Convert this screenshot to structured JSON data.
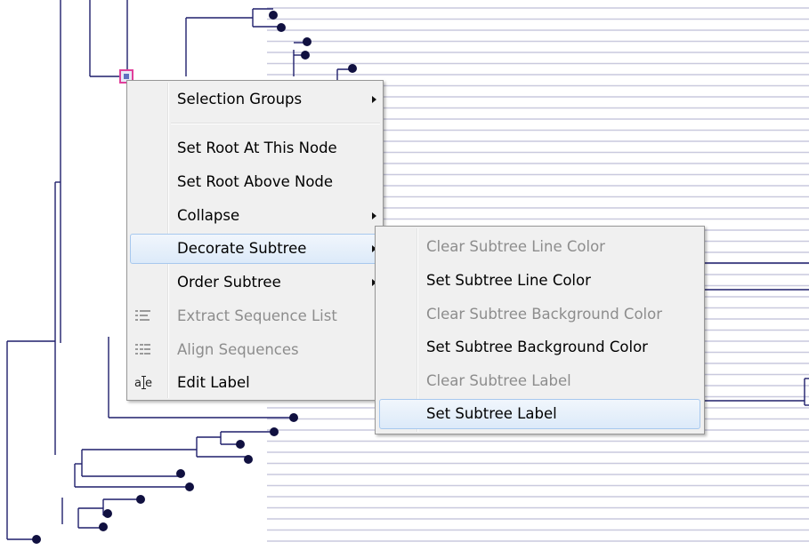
{
  "colors": {
    "tree_line": "#1f1f6b",
    "node_dot": "#101040",
    "guide_line": "#c9c9de",
    "selected_node": "#e0409a",
    "menu_bg": "#f0f0f0",
    "highlight_border": "#a7c8ee",
    "disabled_text": "#8d8d8d"
  },
  "context_menu": {
    "items": [
      {
        "label": "Selection Groups",
        "submenu": true,
        "enabled": true
      },
      {
        "label": "Set Root At This Node",
        "submenu": false,
        "enabled": true
      },
      {
        "label": "Set Root Above Node",
        "submenu": false,
        "enabled": true
      },
      {
        "label": "Collapse",
        "submenu": true,
        "enabled": true
      },
      {
        "label": "Decorate Subtree",
        "submenu": true,
        "enabled": true,
        "highlighted": true
      },
      {
        "label": "Order Subtree",
        "submenu": true,
        "enabled": true
      },
      {
        "label": "Extract Sequence List",
        "submenu": false,
        "enabled": false,
        "icon": "list-icon"
      },
      {
        "label": "Align Sequences",
        "submenu": false,
        "enabled": false,
        "icon": "align-sequences-icon"
      },
      {
        "label": "Edit Label",
        "submenu": false,
        "enabled": true,
        "icon": "edit-label-icon"
      }
    ]
  },
  "decorate_submenu": {
    "items": [
      {
        "label": "Clear Subtree Line Color",
        "enabled": false
      },
      {
        "label": "Set Subtree Line Color",
        "enabled": true
      },
      {
        "label": "Clear Subtree Background Color",
        "enabled": false
      },
      {
        "label": "Set Subtree Background Color",
        "enabled": true
      },
      {
        "label": "Clear Subtree Label",
        "enabled": false
      },
      {
        "label": "Set Subtree Label",
        "enabled": true,
        "highlighted": true
      }
    ]
  }
}
